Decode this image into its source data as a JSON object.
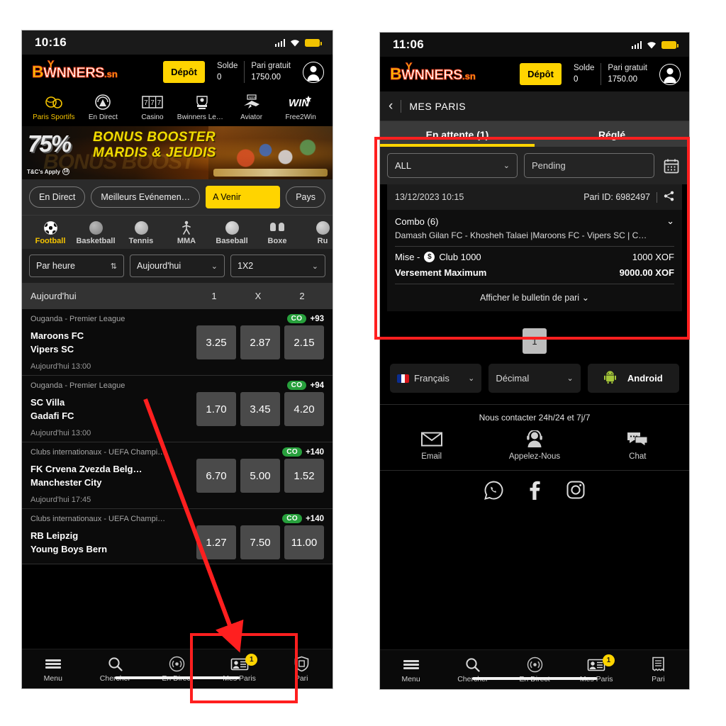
{
  "left_phone": {
    "status": {
      "time": "10:16",
      "signal_icon": "signal-bars-icon",
      "wifi_icon": "wifi-icon",
      "battery_icon": "battery-icon"
    },
    "header": {
      "logo": {
        "b": "B",
        "w": "W",
        "rest": "NNERS",
        "tld": ".sn",
        "kick": "Y"
      },
      "deposit_label": "Dépôt",
      "balance_label": "Solde",
      "balance_value": "0",
      "freebet_label": "Pari gratuit",
      "freebet_value": "1750.00",
      "avatar_icon": "user-avatar-icon"
    },
    "categories": [
      {
        "label": "Paris Sportifs",
        "icon": "sports-balls-icon",
        "active": true
      },
      {
        "label": "En Direct",
        "icon": "live-broadcast-icon",
        "active": false
      },
      {
        "label": "Casino",
        "icon": "slot-777-icon",
        "active": false
      },
      {
        "label": "Bwinners Lea…",
        "icon": "bwinners-leagues-icon",
        "active": false
      },
      {
        "label": "Aviator",
        "icon": "aviator-plane-icon",
        "active": false
      },
      {
        "label": "Free2Win",
        "icon": "win-star-icon",
        "active": false
      }
    ],
    "banner": {
      "percent": "75%",
      "line1": "BONUS BOOSTER",
      "line2": "MARDIS & JEUDIS",
      "ghost": "BONUS BOOST",
      "terms": "T&C's Apply",
      "terms_icon": "age-restriction-icon"
    },
    "chips": [
      {
        "label": "En Direct",
        "selected": false
      },
      {
        "label": "Meilleurs Evénemen…",
        "selected": false
      },
      {
        "label": "A Venir",
        "selected": true
      },
      {
        "label": "Pays",
        "selected": false
      }
    ],
    "sports": [
      {
        "label": "Football",
        "icon": "soccer-ball-icon",
        "active": true
      },
      {
        "label": "Basketball",
        "icon": "basketball-icon",
        "active": false
      },
      {
        "label": "Tennis",
        "icon": "tennis-ball-icon",
        "active": false
      },
      {
        "label": "MMA",
        "icon": "mma-fighter-icon",
        "active": false
      },
      {
        "label": "Baseball",
        "icon": "baseball-icon",
        "active": false
      },
      {
        "label": "Boxe",
        "icon": "boxing-gloves-icon",
        "active": false
      },
      {
        "label": "Ru",
        "icon": "rugby-ball-icon",
        "active": false
      }
    ],
    "selects": [
      {
        "label": "Par heure",
        "icon": "sort-arrows-icon"
      },
      {
        "label": "Aujourd'hui",
        "icon": "chevron-down-icon"
      },
      {
        "label": "1X2",
        "icon": "chevron-down-icon"
      }
    ],
    "odds_header": {
      "title": "Aujourd'hui",
      "col1": "1",
      "colX": "X",
      "col2": "2"
    },
    "matches": [
      {
        "league": "Ouganda - Premier League",
        "cashout": "CO",
        "extra_markets": "+93",
        "home": "Maroons FC",
        "away": "Vipers SC",
        "odds": [
          "3.25",
          "2.87",
          "2.15"
        ],
        "time": "Aujourd'hui 13:00"
      },
      {
        "league": "Ouganda - Premier League",
        "cashout": "CO",
        "extra_markets": "+94",
        "home": "SC Villa",
        "away": "Gadafi FC",
        "odds": [
          "1.70",
          "3.45",
          "4.20"
        ],
        "time": "Aujourd'hui 13:00"
      },
      {
        "league": "Clubs internationaux - UEFA Champi…",
        "cashout": "CO",
        "extra_markets": "+140",
        "home": "FK Crvena Zvezda Belg…",
        "away": "Manchester City",
        "odds": [
          "6.70",
          "5.00",
          "1.52"
        ],
        "time": "Aujourd'hui 17:45"
      },
      {
        "league": "Clubs internationaux - UEFA Champi…",
        "cashout": "CO",
        "extra_markets": "+140",
        "home": "RB Leipzig",
        "away": "Young Boys Bern",
        "odds": [
          "1.27",
          "7.50",
          "11.00"
        ],
        "time": ""
      }
    ],
    "bottom_nav": [
      {
        "label": "Menu",
        "icon": "hamburger-menu-icon",
        "badge": ""
      },
      {
        "label": "Chercher",
        "icon": "search-icon",
        "badge": ""
      },
      {
        "label": "En Direct",
        "icon": "live-signal-icon",
        "badge": ""
      },
      {
        "label": "Mes Paris",
        "icon": "my-bets-icon",
        "badge": "1"
      },
      {
        "label": "Pari",
        "icon": "betslip-shield-icon",
        "badge": ""
      }
    ]
  },
  "right_phone": {
    "status": {
      "time": "11:06",
      "signal_icon": "signal-bars-icon",
      "wifi_icon": "wifi-icon",
      "battery_icon": "battery-icon"
    },
    "header": {
      "logo": {
        "b": "B",
        "w": "W",
        "rest": "NNERS",
        "tld": ".sn",
        "kick": "Y"
      },
      "deposit_label": "Dépôt",
      "balance_label": "Solde",
      "balance_value": "0",
      "freebet_label": "Pari gratuit",
      "freebet_value": "1750.00",
      "avatar_icon": "user-avatar-icon"
    },
    "page_header": {
      "back_icon": "back-chevron-icon",
      "title": "MES PARIS"
    },
    "tabs": [
      {
        "label": "En attente (1)",
        "active": true
      },
      {
        "label": "Réglé",
        "active": false
      }
    ],
    "filters": {
      "status_select": "ALL",
      "state_input_value": "Pending",
      "calendar_icon": "calendar-icon"
    },
    "bet_card": {
      "placed_at": "13/12/2023 10:15",
      "bet_id_label": "Pari ID: 6982497",
      "share_icon": "share-icon",
      "type": "Combo (6)",
      "expand_icon": "chevron-down-icon",
      "selections": "Damash Gilan FC - Khosheh Talaei |Maroons FC - Vipers SC | C…",
      "stake_label": "Mise -",
      "stake_club": "Club 1000",
      "stake_amount": "1000 XOF",
      "payout_label": "Versement Maximum",
      "payout_amount": "9000.00 XOF",
      "show_slip_label": "Afficher le bulletin de pari"
    },
    "pager": {
      "current": "1"
    },
    "settings": [
      {
        "label": "Français",
        "icon": "france-flag-icon",
        "caret": true
      },
      {
        "label": "Décimal",
        "icon": "chevron-down-icon",
        "caret": true
      },
      {
        "label": "Android",
        "icon": "android-robot-icon",
        "caret": false
      }
    ],
    "contact": {
      "caption": "Nous contacter 24h/24 et 7j/7",
      "items": [
        {
          "label": "Email",
          "icon": "envelope-icon"
        },
        {
          "label": "Appelez-Nous",
          "icon": "headset-agent-icon"
        },
        {
          "label": "Chat",
          "icon": "chat-bubbles-icon"
        }
      ]
    },
    "social": [
      {
        "icon": "whatsapp-icon"
      },
      {
        "icon": "facebook-icon"
      },
      {
        "icon": "instagram-icon"
      }
    ],
    "bottom_nav": [
      {
        "label": "Menu",
        "icon": "hamburger-menu-icon",
        "badge": ""
      },
      {
        "label": "Chercher",
        "icon": "search-icon",
        "badge": ""
      },
      {
        "label": "En Direct",
        "icon": "live-signal-icon",
        "badge": ""
      },
      {
        "label": "Mes Paris",
        "icon": "my-bets-icon",
        "badge": "1"
      },
      {
        "label": "Pari",
        "icon": "betslip-receipt-icon",
        "badge": ""
      }
    ]
  },
  "annotations": {
    "accent_color": "#ff1f1f",
    "arrow": {
      "from": [
        205,
        565
      ],
      "to": [
        330,
        905
      ]
    },
    "boxes": [
      "mes-paris-nav-left",
      "mes-paris-panel-right"
    ]
  }
}
